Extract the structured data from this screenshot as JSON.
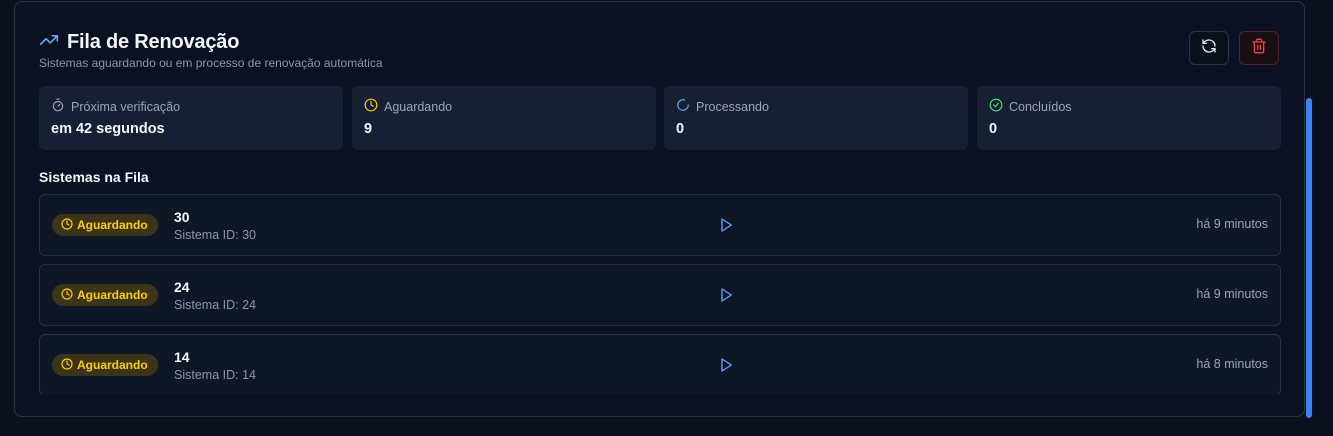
{
  "header": {
    "title": "Fila de Renovação",
    "subtitle": "Sistemas aguardando ou em processo de renovação automática"
  },
  "stats": [
    {
      "label": "Próxima verificação",
      "value": "em 42 segundos",
      "icon": "timer-icon",
      "color": "#9aa5b8"
    },
    {
      "label": "Aguardando",
      "value": "9",
      "icon": "clock-icon",
      "color": "#facc15"
    },
    {
      "label": "Processando",
      "value": "0",
      "icon": "loader-icon",
      "color": "#60a5fa"
    },
    {
      "label": "Concluídos",
      "value": "0",
      "icon": "check-circle-icon",
      "color": "#4ade80"
    }
  ],
  "queue": {
    "title": "Sistemas na Fila",
    "rows": [
      {
        "status": "Aguardando",
        "name": "30",
        "id_text": "Sistema ID: 30",
        "time": "há 9 minutos"
      },
      {
        "status": "Aguardando",
        "name": "24",
        "id_text": "Sistema ID: 24",
        "time": "há 9 minutos"
      },
      {
        "status": "Aguardando",
        "name": "14",
        "id_text": "Sistema ID: 14",
        "time": "há 8 minutos"
      }
    ]
  },
  "colors": {
    "accent": "#3b82f6",
    "warning": "#facc15",
    "danger": "#ef4444",
    "success": "#4ade80"
  }
}
